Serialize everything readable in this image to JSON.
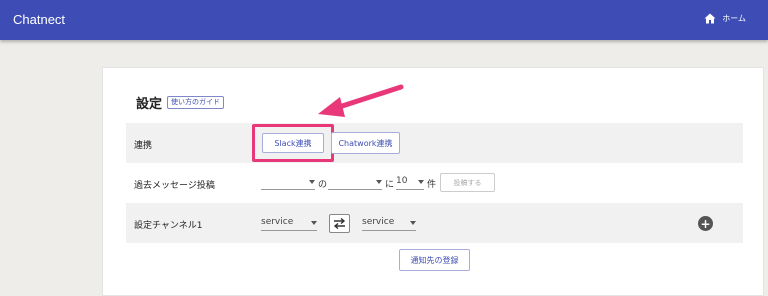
{
  "appbar": {
    "title": "Chatnect",
    "home_label": "ホーム"
  },
  "settings": {
    "heading": "設定",
    "guide_label": "使い方のガイド",
    "integration": {
      "label": "連携",
      "slack_button": "Slack連携",
      "chatwork_button": "Chatwork連携"
    },
    "past_messages": {
      "label": "過去メッセージ投稿",
      "from_value": "",
      "no_text": "の",
      "to_value": "",
      "ni_text": "に",
      "count_value": "10",
      "ken_text": "件",
      "post_button": "投稿する"
    },
    "channel": {
      "label": "設定チャンネル1",
      "source_value": "service",
      "target_value": "service"
    },
    "register_button": "通知先の登録"
  },
  "colors": {
    "brand": "#3d4db5",
    "highlight": "#e8387a"
  },
  "icons": {
    "home": "home-icon",
    "swap": "swap-arrows-icon",
    "add": "add-circle-icon",
    "annotation": "arrow-annotation-icon"
  }
}
